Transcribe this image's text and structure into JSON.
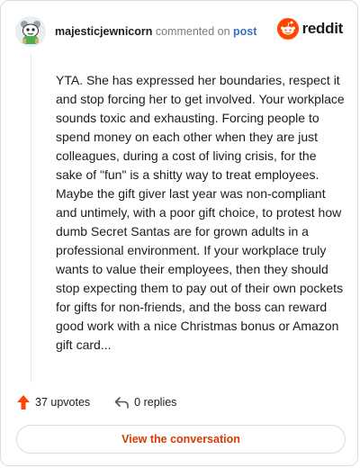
{
  "header": {
    "username": "majesticjewnicorn",
    "action_text": " commented on ",
    "post_link": "post"
  },
  "brand": {
    "wordmark": "reddit",
    "accent": "#ff4500"
  },
  "comment": {
    "body": "YTA. She has expressed her boundaries, respect it and stop forcing her to get involved. Your workplace sounds toxic and exhausting. Forcing people to spend money on each other when they are just colleagues, during a cost of living crisis, for the sake of \"fun\" is a shitty way to treat employees. Maybe the gift giver last year was non-compliant and untimely, with a poor gift choice, to protest how dumb Secret Santas are for grown adults in a professional environment. If your workplace truly wants to value their employees, then they should stop expecting them to pay out of their own pockets for gifts for non-friends, and the boss can reward good work with a nice Christmas bonus or Amazon gift card..."
  },
  "actions": {
    "upvotes": "37 upvotes",
    "replies": "0 replies"
  },
  "cta": {
    "label": "View the conversation"
  },
  "icons": {
    "avatar": "snoo-avatar-icon",
    "logo": "reddit-logo-icon",
    "upvote": "upvote-arrow-icon",
    "reply": "reply-arrow-icon"
  },
  "colors": {
    "link": "#3d6fbf",
    "cta_text": "#d93a00",
    "upvote": "#ff4500"
  }
}
